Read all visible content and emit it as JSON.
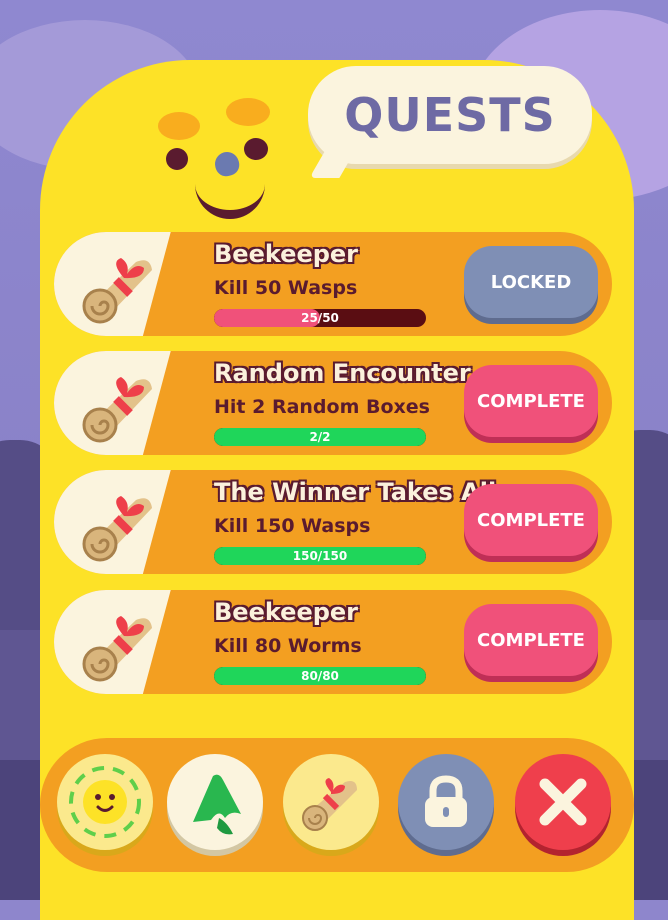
{
  "header": {
    "title": "QUESTS"
  },
  "quests": [
    {
      "title": "Beekeeper",
      "description": "Kill 50 Wasps",
      "progress_text": "25/50",
      "progress": 0.5,
      "button_label": "LOCKED",
      "state": "locked"
    },
    {
      "title": "Random Encounter",
      "description": "Hit 2 Random Boxes",
      "progress_text": "2/2",
      "progress": 1.0,
      "button_label": "COMPLETE",
      "state": "complete"
    },
    {
      "title": "The Winner Takes All",
      "description": "Kill 150 Wasps",
      "progress_text": "150/150",
      "progress": 1.0,
      "button_label": "COMPLETE",
      "state": "complete"
    },
    {
      "title": "Beekeeper",
      "description": "Kill 80 Worms",
      "progress_text": "80/80",
      "progress": 1.0,
      "button_label": "COMPLETE",
      "state": "complete"
    }
  ],
  "bottom_nav": [
    {
      "icon": "bee-face-icon"
    },
    {
      "icon": "leaf-icon"
    },
    {
      "icon": "scroll-icon"
    },
    {
      "icon": "lock-icon"
    },
    {
      "icon": "close-icon"
    }
  ],
  "colors": {
    "card": "#fde227",
    "quest_row": "#f39f21",
    "complete_button": "#f0517a",
    "locked_button": "#7f8fb5",
    "progress_pink": "#f0517a",
    "progress_green": "#1fd65a",
    "close_button": "#ef3f4c"
  }
}
